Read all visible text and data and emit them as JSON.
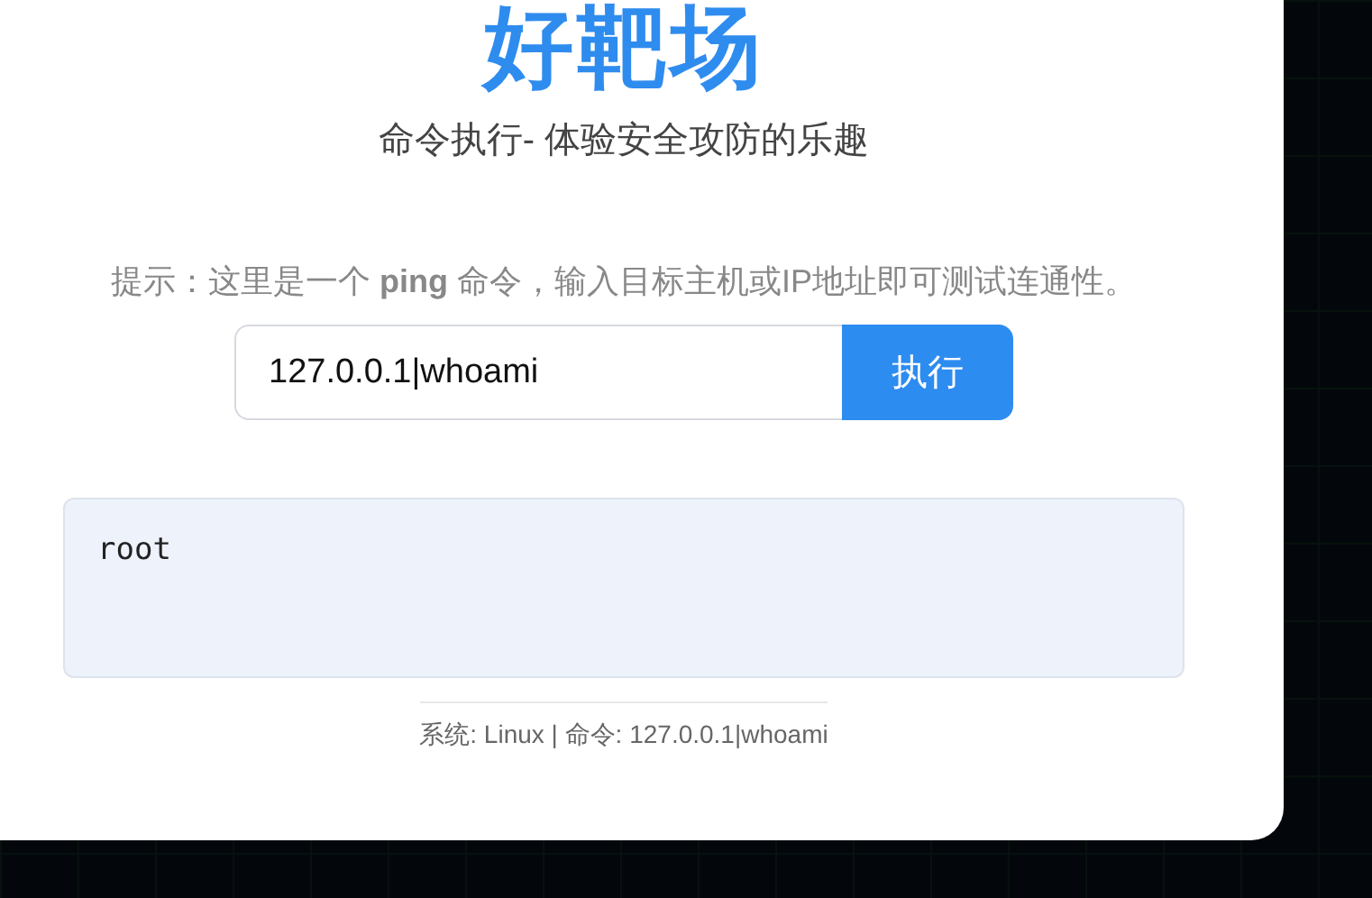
{
  "title": "好靶场",
  "subtitle": "命令执行- 体验安全攻防的乐趣",
  "hint": "提示：这里是一个 **ping** 命令，输入目标主机或IP地址即可测试连通性。",
  "command_field": {
    "value": "127.0.0.1|whoami"
  },
  "run_button": "执行",
  "output": "root",
  "footer": "系统: Linux | 命令: 127.0.0.1|whoami"
}
